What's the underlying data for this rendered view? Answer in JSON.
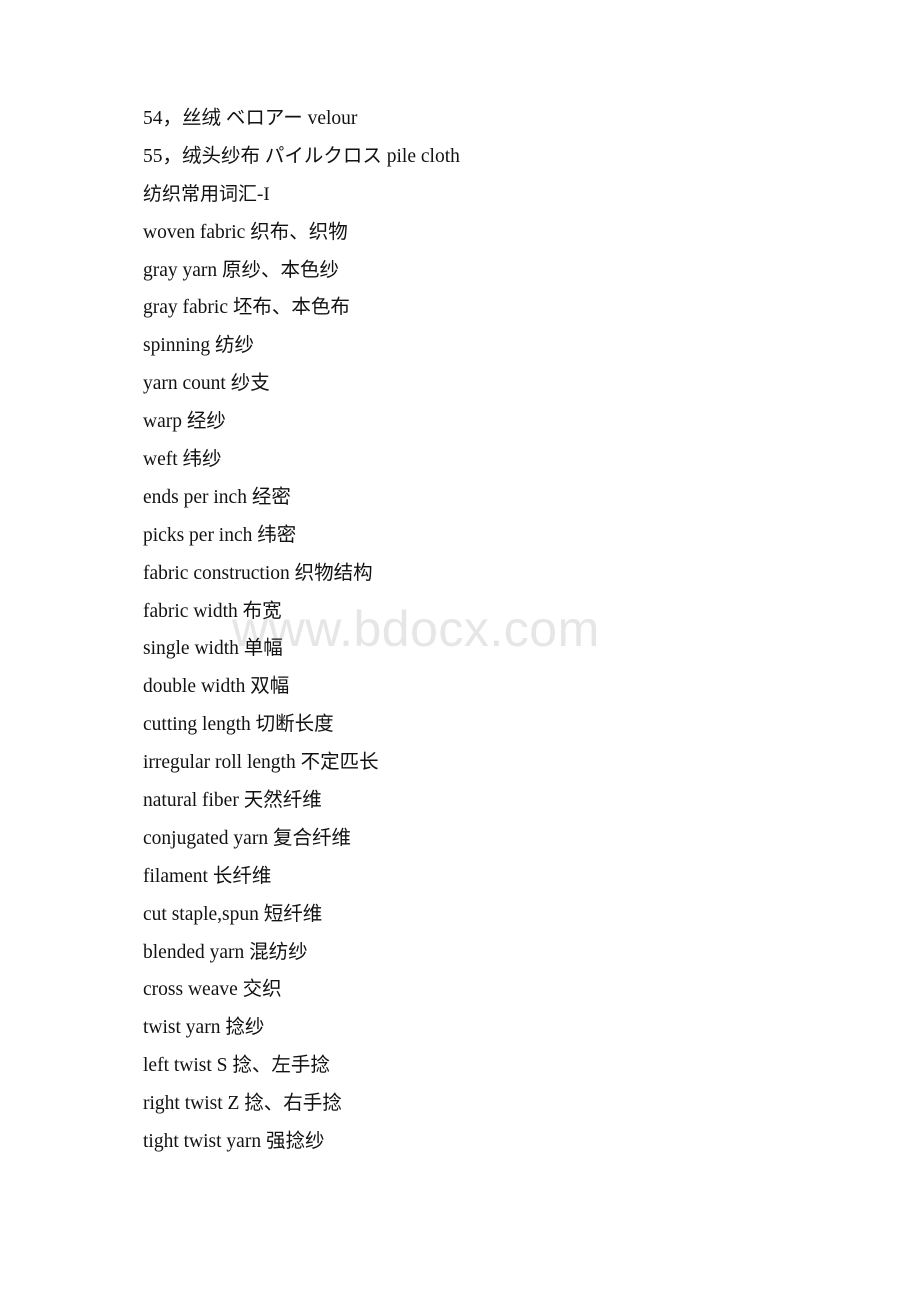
{
  "document": {
    "watermark": "www.bdocx.com",
    "heading": "纺织常用词汇-I",
    "lines": [
      {
        "text": "54，丝绒 ベロアー velour"
      },
      {
        "text": "55，绒头纱布 パイルクロス pile cloth"
      },
      {
        "text": "纺织常用词汇-I"
      },
      {
        "text": "woven fabric 织布、织物"
      },
      {
        "text": "gray yarn 原纱、本色纱"
      },
      {
        "text": "gray fabric 坯布、本色布"
      },
      {
        "text": "spinning 纺纱"
      },
      {
        "text": "yarn count 纱支"
      },
      {
        "text": "warp 经纱"
      },
      {
        "text": "weft 纬纱"
      },
      {
        "text": "ends per inch 经密"
      },
      {
        "text": "picks per inch 纬密"
      },
      {
        "text": "fabric construction 织物结构"
      },
      {
        "text": "fabric width 布宽"
      },
      {
        "text": "single width 单幅"
      },
      {
        "text": "double width 双幅"
      },
      {
        "text": "cutting length 切断长度"
      },
      {
        "text": "irregular roll length 不定匹长"
      },
      {
        "text": "natural fiber 天然纤维"
      },
      {
        "text": "conjugated yarn 复合纤维"
      },
      {
        "text": "filament 长纤维"
      },
      {
        "text": "cut staple,spun 短纤维"
      },
      {
        "text": "blended yarn 混纺纱"
      },
      {
        "text": "cross weave 交织"
      },
      {
        "text": "twist yarn 捻纱"
      },
      {
        "text": "left twist S 捻、左手捻"
      },
      {
        "text": "right twist Z 捻、右手捻"
      },
      {
        "text": "tight twist yarn 强捻纱"
      }
    ]
  }
}
